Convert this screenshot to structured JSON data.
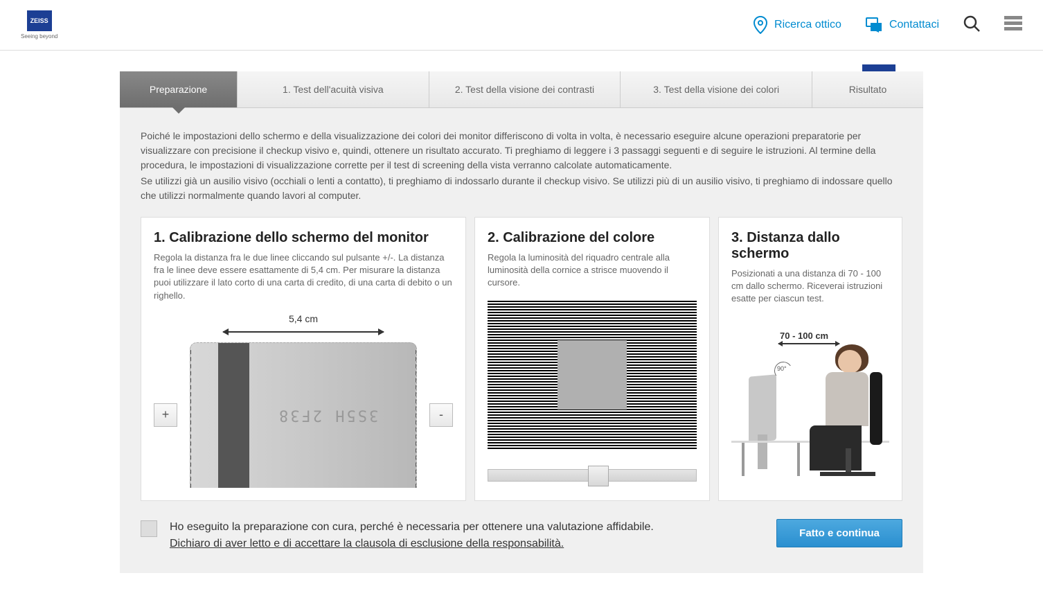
{
  "header": {
    "logo_text": "ZEISS",
    "logo_tagline": "Seeing beyond",
    "optician_search": "Ricerca ottico",
    "contact": "Contattaci"
  },
  "tabs": [
    {
      "label": "Preparazione",
      "active": true
    },
    {
      "label": "1. Test dell'acuità visiva",
      "active": false
    },
    {
      "label": "2. Test della visione dei contrasti",
      "active": false
    },
    {
      "label": "3. Test della visione dei colori",
      "active": false
    },
    {
      "label": "Risultato",
      "active": false
    }
  ],
  "intro": {
    "p1": "Poiché le impostazioni dello schermo e della visualizzazione dei colori dei monitor differiscono di volta in volta, è necessario eseguire alcune operazioni preparatorie per visualizzare con precisione il checkup visivo e, quindi, ottenere un risultato accurato. Ti preghiamo di leggere i 3 passaggi seguenti e di seguire le istruzioni. Al termine della procedura, le impostazioni di visualizzazione corrette per il test di screening della vista verranno calcolate automaticamente.",
    "p2": "Se utilizzi già un ausilio visivo (occhiali o lenti a contatto), ti preghiamo di indossarlo durante il checkup visivo. Se utilizzi più di un ausilio visivo, ti preghiamo di indossare quello che utilizzi normalmente quando lavori al computer."
  },
  "panel1": {
    "title": "1. Calibrazione dello schermo del monitor",
    "desc": "Regola la distanza fra le due linee cliccando sul pulsante +/-. La distanza fra le linee deve essere esattamente di 5,4 cm. Per misurare la distanza puoi utilizzare il lato corto di una carta di credito, di una carta di debito o un righello.",
    "measurement": "5,4 cm",
    "plus": "+",
    "minus": "-",
    "card_digits": "3S5H 2F38"
  },
  "panel2": {
    "title": "2. Calibrazione del colore",
    "desc": "Regola la luminosità del riquadro centrale alla luminosità della cornice a strisce muovendo il cursore."
  },
  "panel3": {
    "title": "3. Distanza dallo schermo",
    "desc": "Posizionati a una distanza di 70 - 100 cm dallo schermo. Riceverai istruzioni esatte per ciascun test.",
    "distance_label": "70 - 100 cm",
    "angle": "90°"
  },
  "footer": {
    "check_text": "Ho eseguito la preparazione con cura, perché è necessaria per ottenere una valutazione affidabile.",
    "disclaimer_link": "Dichiaro di aver letto e di accettare la clausola di esclusione della responsabilità.",
    "continue_btn": "Fatto e continua"
  }
}
